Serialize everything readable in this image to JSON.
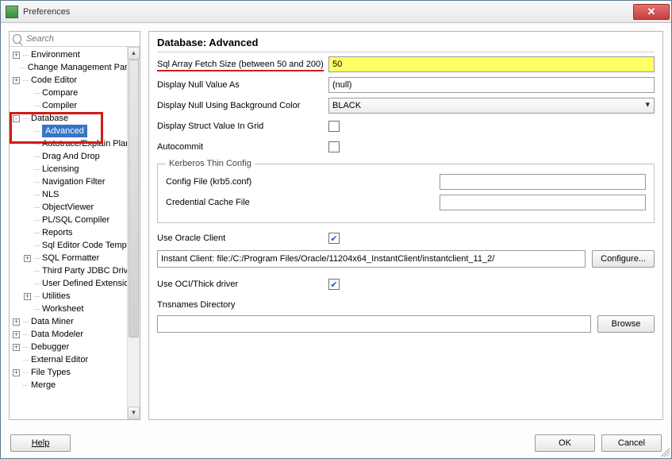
{
  "window": {
    "title": "Preferences"
  },
  "search": {
    "placeholder": "Search"
  },
  "tree": [
    {
      "lvl": 0,
      "exp": "+",
      "label": "Environment"
    },
    {
      "lvl": 0,
      "exp": "",
      "label": "Change Management Param"
    },
    {
      "lvl": 0,
      "exp": "+",
      "label": "Code Editor"
    },
    {
      "lvl": 1,
      "exp": "",
      "label": "Compare"
    },
    {
      "lvl": 1,
      "exp": "",
      "label": "Compiler"
    },
    {
      "lvl": 0,
      "exp": "-",
      "label": "Database"
    },
    {
      "lvl": 1,
      "exp": "",
      "label": "Advanced",
      "selected": true
    },
    {
      "lvl": 1,
      "exp": "",
      "label": "Autotrace/Explain Plan"
    },
    {
      "lvl": 1,
      "exp": "",
      "label": "Drag And Drop"
    },
    {
      "lvl": 1,
      "exp": "",
      "label": "Licensing"
    },
    {
      "lvl": 1,
      "exp": "",
      "label": "Navigation Filter"
    },
    {
      "lvl": 1,
      "exp": "",
      "label": "NLS"
    },
    {
      "lvl": 1,
      "exp": "",
      "label": "ObjectViewer"
    },
    {
      "lvl": 1,
      "exp": "",
      "label": "PL/SQL Compiler"
    },
    {
      "lvl": 1,
      "exp": "",
      "label": "Reports"
    },
    {
      "lvl": 1,
      "exp": "",
      "label": "Sql Editor Code Templa"
    },
    {
      "lvl": 1,
      "exp": "+",
      "label": "SQL Formatter"
    },
    {
      "lvl": 1,
      "exp": "",
      "label": "Third Party JDBC Driver"
    },
    {
      "lvl": 1,
      "exp": "",
      "label": "User Defined Extension"
    },
    {
      "lvl": 1,
      "exp": "+",
      "label": "Utilities"
    },
    {
      "lvl": 1,
      "exp": "",
      "label": "Worksheet"
    },
    {
      "lvl": 0,
      "exp": "+",
      "label": "Data Miner"
    },
    {
      "lvl": 0,
      "exp": "+",
      "label": "Data Modeler"
    },
    {
      "lvl": 0,
      "exp": "+",
      "label": "Debugger"
    },
    {
      "lvl": 0,
      "exp": "",
      "label": "External Editor"
    },
    {
      "lvl": 0,
      "exp": "+",
      "label": "File Types"
    },
    {
      "lvl": 0,
      "exp": "",
      "label": "Merge"
    }
  ],
  "page": {
    "heading": "Database: Advanced",
    "fetch_label": "Sql Array Fetch Size (between 50 and 200)",
    "fetch_value": "50",
    "null_label": "Display Null Value As",
    "null_value": "(null)",
    "null_bg_label": "Display Null Using Background Color",
    "null_bg_value": "BLACK",
    "struct_label": "Display Struct Value In Grid",
    "autocommit_label": "Autocommit",
    "kerberos_legend": "Kerberos Thin Config",
    "kerberos_config_label": "Config File (krb5.conf)",
    "kerberos_cred_label": "Credential Cache File",
    "use_oracle_label": "Use Oracle Client",
    "oracle_path": "Instant Client: file:/C:/Program Files/Oracle/11204x64_InstantClient/instantclient_11_2/",
    "configure_btn": "Configure...",
    "use_oci_label": "Use OCI/Thick driver",
    "tns_label": "Tnsnames Directory",
    "browse_btn": "Browse"
  },
  "footer": {
    "help": "Help",
    "ok": "OK",
    "cancel": "Cancel"
  }
}
